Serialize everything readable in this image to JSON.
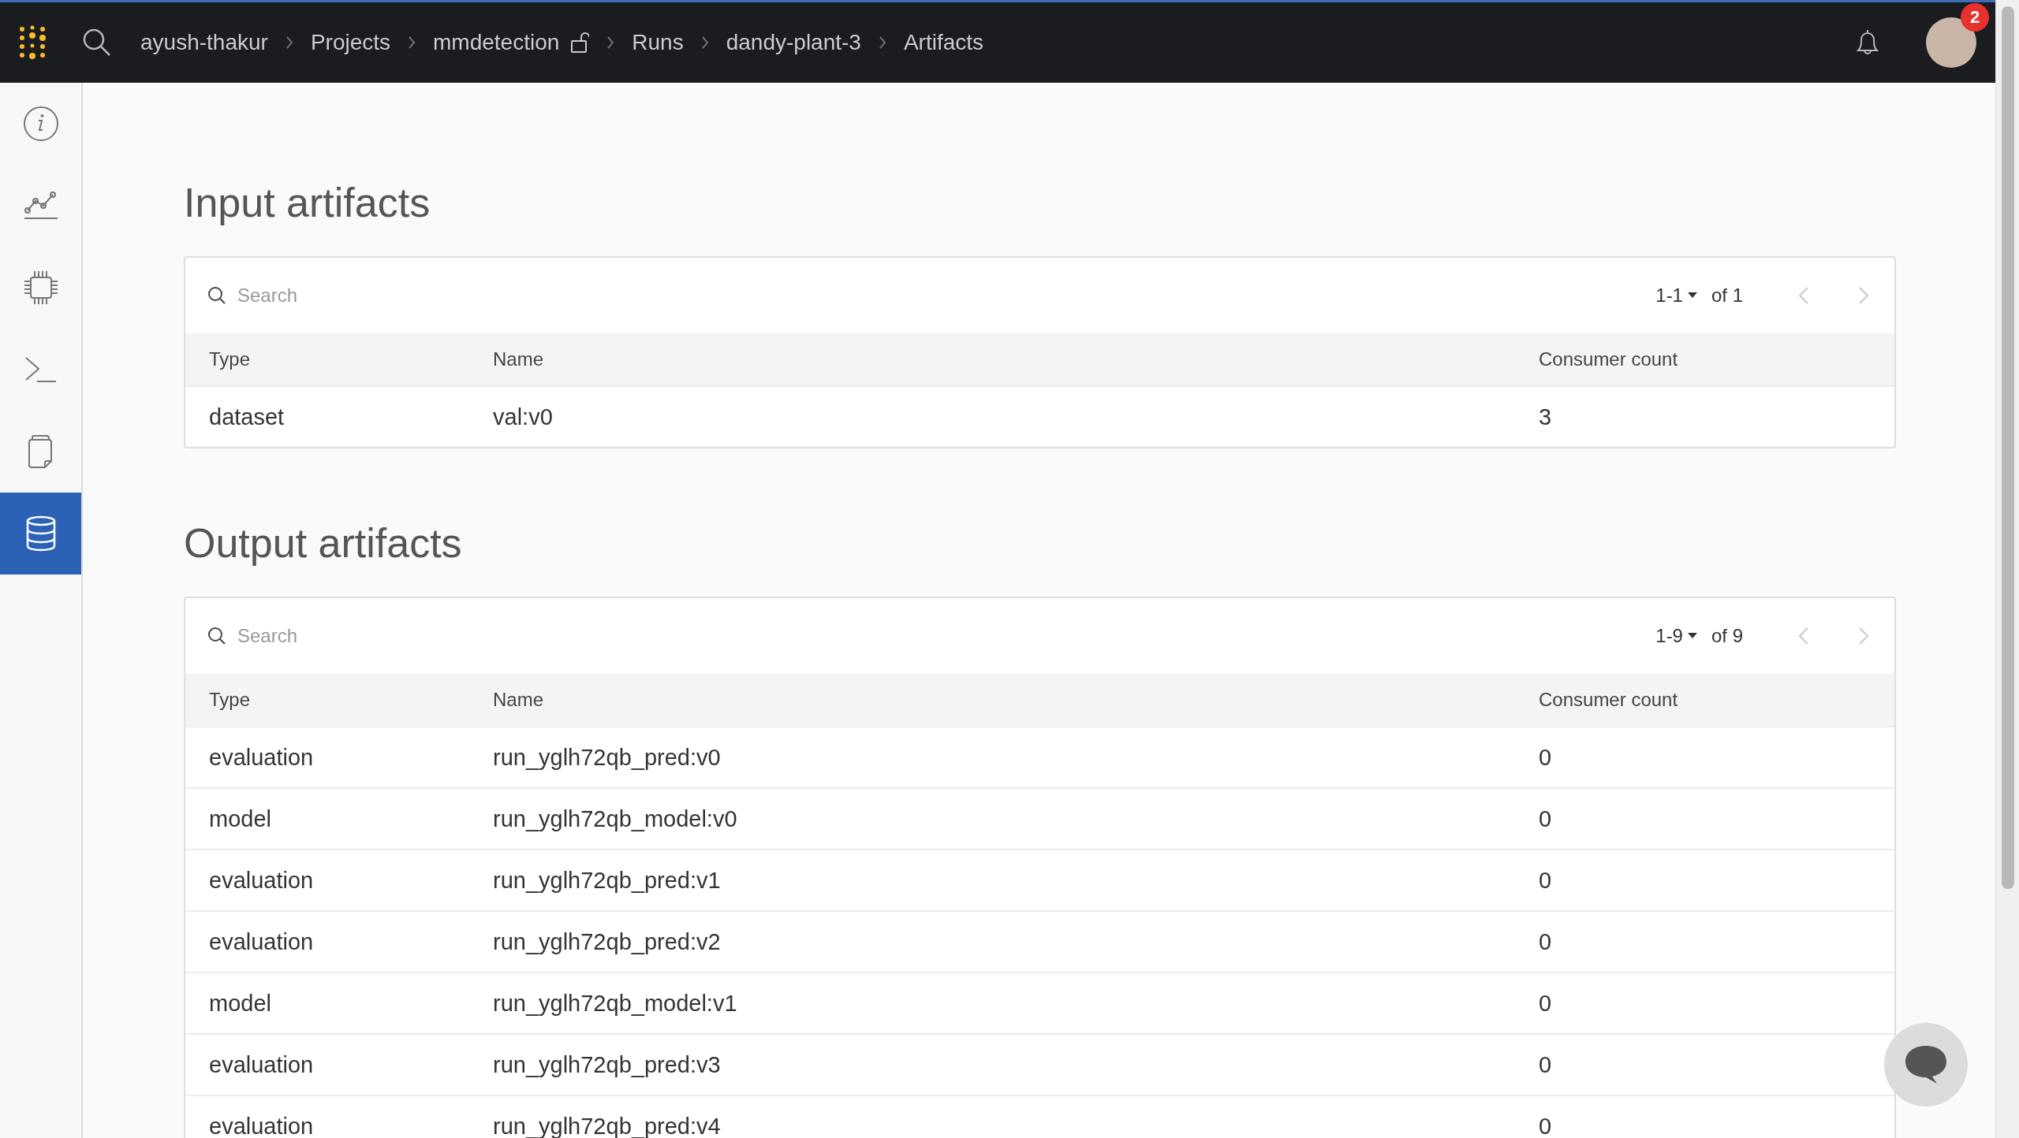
{
  "topbar": {
    "breadcrumbs": [
      {
        "label": "ayush-thakur"
      },
      {
        "label": "Projects"
      },
      {
        "label": "mmdetection",
        "unlocked": true
      },
      {
        "label": "Runs"
      },
      {
        "label": "dandy-plant-3"
      },
      {
        "label": "Artifacts"
      }
    ],
    "notification_count": "2"
  },
  "sidebar": {
    "items": [
      {
        "selected": false
      },
      {
        "selected": false
      },
      {
        "selected": false
      },
      {
        "selected": false
      },
      {
        "selected": false
      },
      {
        "selected": true
      }
    ]
  },
  "sections": [
    {
      "title": "Input artifacts",
      "search": {
        "placeholder": "Search"
      },
      "pagination": {
        "range": "1-1",
        "total": "of 1",
        "prev_disabled": true,
        "next_disabled": true
      },
      "columns": [
        "Type",
        "Name",
        "Consumer count"
      ],
      "rows": [
        [
          "dataset",
          "val:v0",
          "3"
        ]
      ]
    },
    {
      "title": "Output artifacts",
      "search": {
        "placeholder": "Search"
      },
      "pagination": {
        "range": "1-9",
        "total": "of 9",
        "prev_disabled": true,
        "next_disabled": true
      },
      "columns": [
        "Type",
        "Name",
        "Consumer count"
      ],
      "rows": [
        [
          "evaluation",
          "run_yglh72qb_pred:v0",
          "0"
        ],
        [
          "model",
          "run_yglh72qb_model:v0",
          "0"
        ],
        [
          "evaluation",
          "run_yglh72qb_pred:v1",
          "0"
        ],
        [
          "evaluation",
          "run_yglh72qb_pred:v2",
          "0"
        ],
        [
          "model",
          "run_yglh72qb_model:v1",
          "0"
        ],
        [
          "evaluation",
          "run_yglh72qb_pred:v3",
          "0"
        ],
        [
          "evaluation",
          "run_yglh72qb_pred:v4",
          "0"
        ]
      ]
    }
  ]
}
